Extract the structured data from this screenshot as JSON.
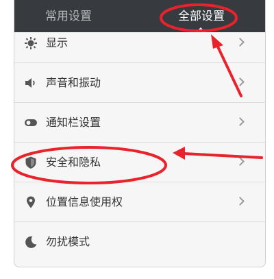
{
  "header": {
    "tabs": [
      {
        "label": "常用设置",
        "active": false
      },
      {
        "label": "全部设置",
        "active": true
      }
    ]
  },
  "settings": {
    "items": [
      {
        "label": "显示",
        "icon": "brightness-icon"
      },
      {
        "label": "声音和振动",
        "icon": "speaker-icon"
      },
      {
        "label": "通知栏设置",
        "icon": "toggle-icon"
      },
      {
        "label": "安全和隐私",
        "icon": "shield-icon"
      },
      {
        "label": "位置信息使用权",
        "icon": "location-pin-icon"
      },
      {
        "label": "勿扰模式",
        "icon": "moon-icon"
      }
    ]
  },
  "colors": {
    "header_bg": "#373a3f",
    "list_bg": "#f6f6f6",
    "annotation_red": "#e8232c"
  }
}
